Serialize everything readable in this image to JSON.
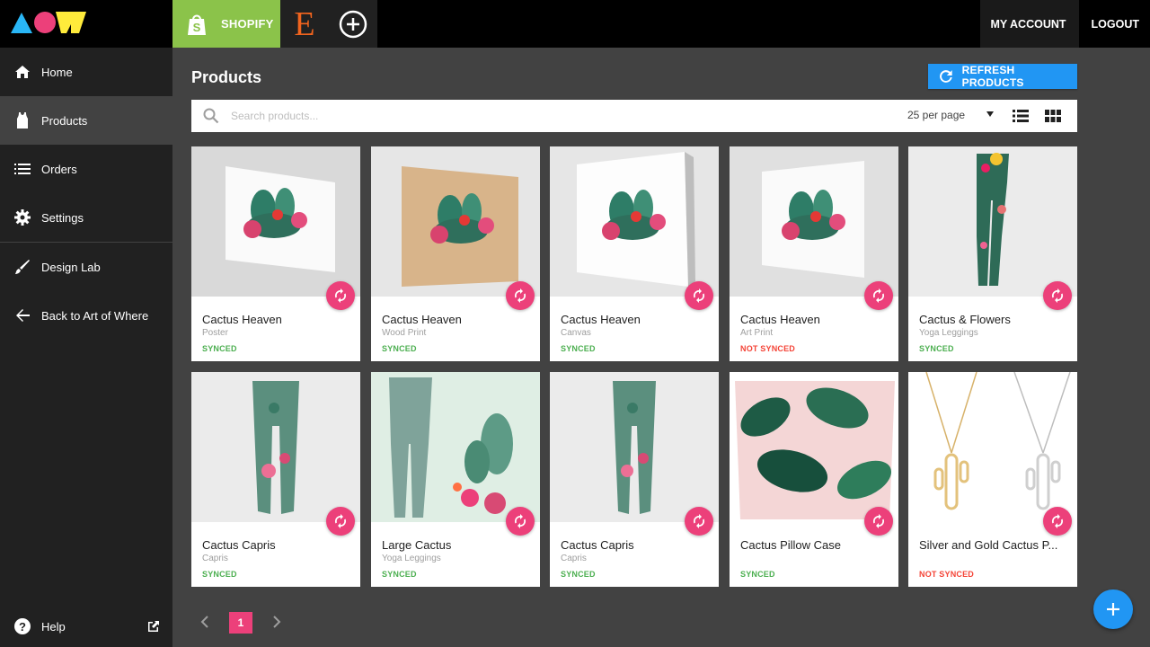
{
  "topbar": {
    "logo_icon": "aow-logo-icon",
    "tabs": [
      {
        "label": "SHOPIFY",
        "icon": "shopify-bag-icon",
        "color": "#8bc34a"
      },
      {
        "label": "E",
        "icon": "etsy-icon",
        "color": "#f1641e"
      },
      {
        "label": "",
        "icon": "add-circle-icon"
      }
    ],
    "my_account": "MY ACCOUNT",
    "logout": "LOGOUT"
  },
  "sidebar": {
    "items": [
      {
        "label": "Home",
        "icon": "home-icon"
      },
      {
        "label": "Products",
        "icon": "tank-top-icon",
        "active": true
      },
      {
        "label": "Orders",
        "icon": "list-icon"
      },
      {
        "label": "Settings",
        "icon": "gear-icon"
      },
      {
        "label": "Design Lab",
        "icon": "brush-icon"
      },
      {
        "label": "Back to Art of Where",
        "icon": "arrow-back-icon"
      }
    ],
    "help": {
      "label": "Help",
      "icon": "help-circle-icon",
      "ext_icon": "external-link-icon"
    }
  },
  "main": {
    "title": "Products",
    "refresh_label": "REFRESH PRODUCTS",
    "search": {
      "placeholder": "Search products..."
    },
    "per_page": "25 per page"
  },
  "products": [
    {
      "name": "Cactus Heaven",
      "type": "Poster",
      "status": "SYNCED",
      "synced": true
    },
    {
      "name": "Cactus Heaven",
      "type": "Wood Print",
      "status": "SYNCED",
      "synced": true
    },
    {
      "name": "Cactus Heaven",
      "type": "Canvas",
      "status": "SYNCED",
      "synced": true
    },
    {
      "name": "Cactus Heaven",
      "type": "Art Print",
      "status": "NOT SYNCED",
      "synced": false
    },
    {
      "name": "Cactus & Flowers",
      "type": "Yoga Leggings",
      "status": "SYNCED",
      "synced": true
    },
    {
      "name": "Cactus Capris",
      "type": "Capris",
      "status": "SYNCED",
      "synced": true
    },
    {
      "name": "Large Cactus",
      "type": "Yoga Leggings",
      "status": "SYNCED",
      "synced": true
    },
    {
      "name": "Cactus Capris",
      "type": "Capris",
      "status": "SYNCED",
      "synced": true
    },
    {
      "name": "Cactus Pillow Case",
      "type": "",
      "status": "SYNCED",
      "synced": true
    },
    {
      "name": "Silver and Gold Cactus P...",
      "type": "",
      "status": "NOT SYNCED",
      "synced": false
    }
  ],
  "pagination": {
    "current": "1"
  },
  "colors": {
    "accent": "#ec407a",
    "primary": "#2196f3",
    "synced": "#4caf50",
    "not_synced": "#f44336"
  }
}
